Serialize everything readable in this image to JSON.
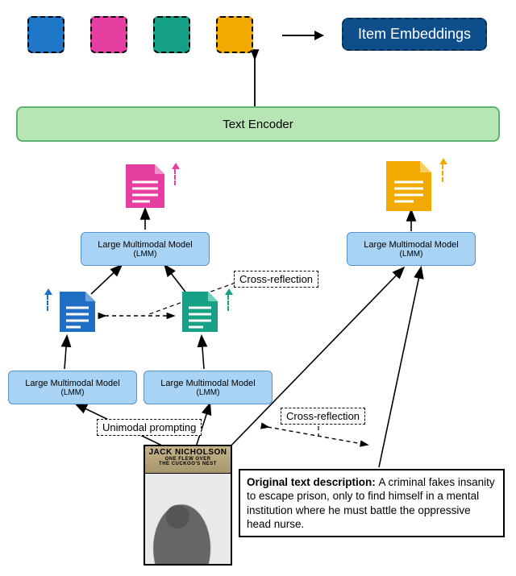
{
  "tokens": {
    "colors": [
      "#1f77c9",
      "#e63fa1",
      "#16a085",
      "#f2a900"
    ]
  },
  "item_embeddings_label": "Item Embeddings",
  "encoder_label": "Text Encoder",
  "lmm": {
    "line1": "Large Multimodal Model",
    "line2": "(LMM)"
  },
  "labels": {
    "cross_reflection": "Cross-reflection",
    "unimodal_prompting": "Unimodal prompting"
  },
  "poster": {
    "star": "JACK NICHOLSON",
    "title1": "ONE FLEW OVER",
    "title2": "THE CUCKOO'S NEST"
  },
  "description": {
    "prefix": "Original text description: ",
    "body": "A criminal fakes insanity to escape prison, only to find himself in a mental institution where he must battle the oppressive head nurse."
  },
  "doc_colors": {
    "blue": "#1f6fc4",
    "pink": "#e63fa1",
    "teal": "#16a085",
    "orange": "#f2a900"
  }
}
